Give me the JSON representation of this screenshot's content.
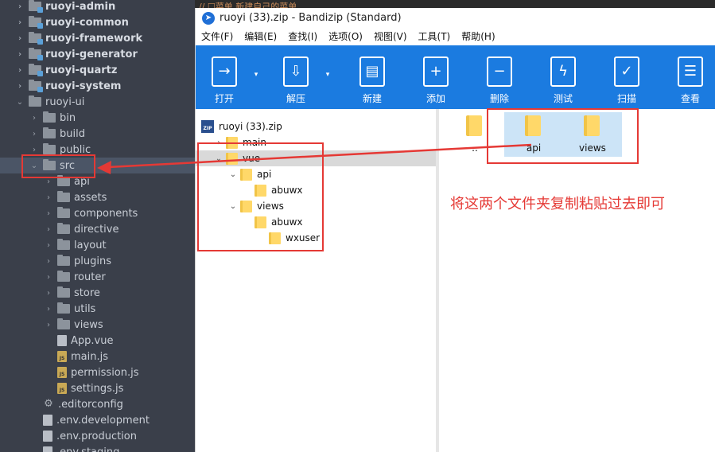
{
  "ide": {
    "code_fragment": "//      ☐菜单 新建自己的菜单",
    "rows": [
      {
        "label": "ruoyi-admin",
        "depth": 1,
        "chev": "›",
        "icon": "module",
        "bold": true
      },
      {
        "label": "ruoyi-common",
        "depth": 1,
        "chev": "›",
        "icon": "module",
        "bold": true
      },
      {
        "label": "ruoyi-framework",
        "depth": 1,
        "chev": "›",
        "icon": "module",
        "bold": true
      },
      {
        "label": "ruoyi-generator",
        "depth": 1,
        "chev": "›",
        "icon": "module",
        "bold": true
      },
      {
        "label": "ruoyi-quartz",
        "depth": 1,
        "chev": "›",
        "icon": "module",
        "bold": true
      },
      {
        "label": "ruoyi-system",
        "depth": 1,
        "chev": "›",
        "icon": "module",
        "bold": true
      },
      {
        "label": "ruoyi-ui",
        "depth": 1,
        "chev": "⌄",
        "icon": "folder",
        "bold": false
      },
      {
        "label": "bin",
        "depth": 2,
        "chev": "›",
        "icon": "folder",
        "bold": false
      },
      {
        "label": "build",
        "depth": 2,
        "chev": "›",
        "icon": "folder",
        "bold": false
      },
      {
        "label": "public",
        "depth": 2,
        "chev": "›",
        "icon": "folder",
        "bold": false
      },
      {
        "label": "src",
        "depth": 2,
        "chev": "⌄",
        "icon": "folder",
        "bold": false,
        "selected": true
      },
      {
        "label": "api",
        "depth": 3,
        "chev": "›",
        "icon": "folder",
        "bold": false
      },
      {
        "label": "assets",
        "depth": 3,
        "chev": "›",
        "icon": "folder",
        "bold": false
      },
      {
        "label": "components",
        "depth": 3,
        "chev": "›",
        "icon": "folder",
        "bold": false
      },
      {
        "label": "directive",
        "depth": 3,
        "chev": "›",
        "icon": "folder",
        "bold": false
      },
      {
        "label": "layout",
        "depth": 3,
        "chev": "›",
        "icon": "folder",
        "bold": false
      },
      {
        "label": "plugins",
        "depth": 3,
        "chev": "›",
        "icon": "folder",
        "bold": false
      },
      {
        "label": "router",
        "depth": 3,
        "chev": "›",
        "icon": "folder",
        "bold": false
      },
      {
        "label": "store",
        "depth": 3,
        "chev": "›",
        "icon": "folder",
        "bold": false
      },
      {
        "label": "utils",
        "depth": 3,
        "chev": "›",
        "icon": "folder",
        "bold": false
      },
      {
        "label": "views",
        "depth": 3,
        "chev": "›",
        "icon": "folder",
        "bold": false
      },
      {
        "label": "App.vue",
        "depth": 3,
        "chev": "",
        "icon": "file",
        "bold": false
      },
      {
        "label": "main.js",
        "depth": 3,
        "chev": "",
        "icon": "js",
        "bold": false
      },
      {
        "label": "permission.js",
        "depth": 3,
        "chev": "",
        "icon": "js",
        "bold": false
      },
      {
        "label": "settings.js",
        "depth": 3,
        "chev": "",
        "icon": "js",
        "bold": false
      },
      {
        "label": ".editorconfig",
        "depth": 2,
        "chev": "",
        "icon": "gear",
        "bold": false
      },
      {
        "label": ".env.development",
        "depth": 2,
        "chev": "",
        "icon": "file",
        "bold": false
      },
      {
        "label": ".env.production",
        "depth": 2,
        "chev": "",
        "icon": "file",
        "bold": false
      },
      {
        "label": ".env.staging",
        "depth": 2,
        "chev": "",
        "icon": "file",
        "bold": false
      }
    ]
  },
  "bandizip": {
    "title": "ruoyi (33).zip - Bandizip (Standard)",
    "menu": [
      "文件(F)",
      "编辑(E)",
      "查找(I)",
      "选项(O)",
      "视图(V)",
      "工具(T)",
      "帮助(H)"
    ],
    "toolbar": [
      {
        "label": "打开",
        "icon": "open-icon",
        "glyph": "→",
        "dropdown": true
      },
      {
        "label": "解压",
        "icon": "extract-icon",
        "glyph": "⇩",
        "dropdown": true
      },
      {
        "label": "新建",
        "icon": "new-archive-icon",
        "glyph": "▤",
        "dropdown": false
      },
      {
        "label": "添加",
        "icon": "add-icon",
        "glyph": "+",
        "dropdown": false
      },
      {
        "label": "删除",
        "icon": "delete-icon",
        "glyph": "−",
        "dropdown": false
      },
      {
        "label": "测试",
        "icon": "test-icon",
        "glyph": "ϟ",
        "dropdown": false
      },
      {
        "label": "扫描",
        "icon": "scan-icon",
        "glyph": "✓",
        "dropdown": false
      },
      {
        "label": "查看",
        "icon": "view-icon",
        "glyph": "☰",
        "dropdown": false
      }
    ],
    "tree": [
      {
        "label": "ruoyi (33).zip",
        "depth": 0,
        "chev": "",
        "icon": "zip"
      },
      {
        "label": "main",
        "depth": 1,
        "chev": "›",
        "icon": "folder"
      },
      {
        "label": "vue",
        "depth": 1,
        "chev": "⌄",
        "icon": "folder",
        "selected": true
      },
      {
        "label": "api",
        "depth": 2,
        "chev": "⌄",
        "icon": "folder"
      },
      {
        "label": "abuwx",
        "depth": 3,
        "chev": "",
        "icon": "folder"
      },
      {
        "label": "views",
        "depth": 2,
        "chev": "⌄",
        "icon": "folder"
      },
      {
        "label": "abuwx",
        "depth": 3,
        "chev": "",
        "icon": "folder"
      },
      {
        "label": "wxuser",
        "depth": 4,
        "chev": "",
        "icon": "folder"
      }
    ],
    "files": [
      {
        "label": "..",
        "selected": false
      },
      {
        "label": "api",
        "selected": true
      },
      {
        "label": "views",
        "selected": true
      }
    ]
  },
  "annotation": {
    "note": "将这两个文件夹复制粘贴过去即可",
    "color": "#e53935"
  }
}
